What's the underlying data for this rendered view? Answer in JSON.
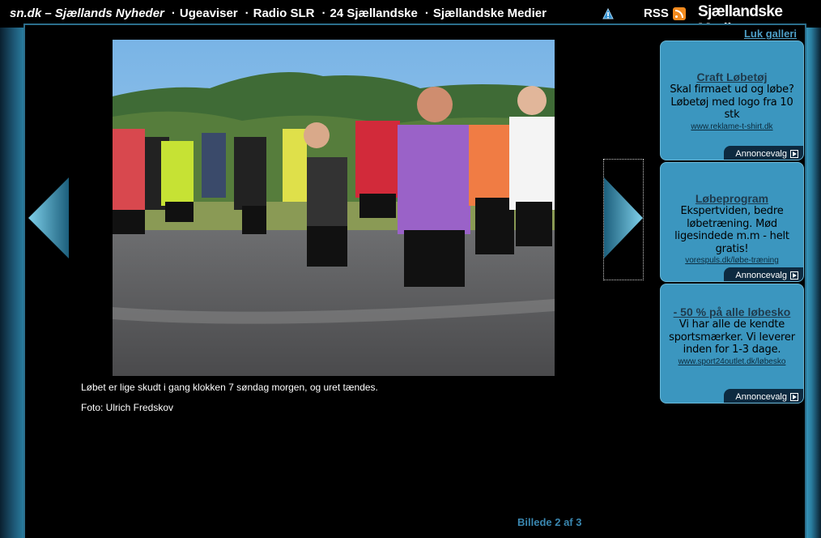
{
  "header": {
    "nav": [
      {
        "label": "sn.dk – Sjællands Nyheder",
        "brand": true
      },
      {
        "label": "Ugeaviser",
        "brand": false
      },
      {
        "label": "Radio SLR",
        "brand": false
      },
      {
        "label": "24 Sjællandske",
        "brand": false
      },
      {
        "label": "Sjællandske Medier",
        "brand": false
      }
    ],
    "rss_label": "RSS",
    "logo_text": "Sjællandske Medier"
  },
  "gallery": {
    "close_label": "Luk galleri",
    "caption": "Løbet er lige skudt i gang klokken 7 søndag morgen, og uret tændes.",
    "credit": "Foto: Ulrich Fredskov",
    "counter": "Billede 2 af 3"
  },
  "ads": [
    {
      "title": "Craft Løbetøj",
      "body": "Skal firmaet ud og løbe? Løbetøj med logo fra 10 stk",
      "url": "www.reklame-t-shirt.dk",
      "choice": "Annoncevalg"
    },
    {
      "title": "Løbeprogram",
      "body": "Ekspertviden, bedre løbetræning. Mød ligesindede m.m - helt gratis!",
      "url": "vorespuls.dk/løbe-træning",
      "choice": "Annoncevalg"
    },
    {
      "title": "- 50 % på alle løbesko",
      "body": "Vi har alle de kendte sportsmærker. Vi leverer inden for 1-3 dage.",
      "url": "www.sport24outlet.dk/løbesko",
      "choice": "Annoncevalg"
    }
  ],
  "colors": {
    "accent_blue": "#3b96bf",
    "link_blue": "#4e9fc7",
    "rss_orange": "#f28a1e"
  }
}
